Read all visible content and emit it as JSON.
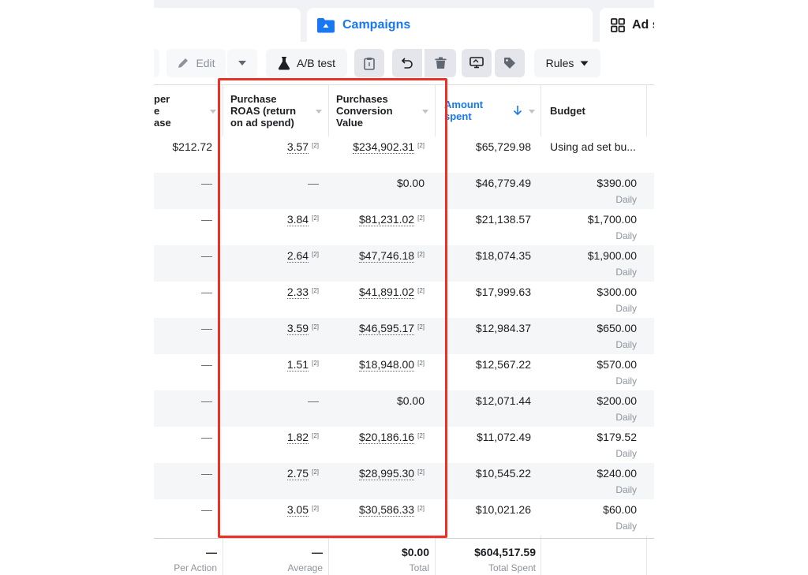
{
  "tabs": {
    "campaigns": "Campaigns",
    "ads": "Ad s"
  },
  "toolbar": {
    "edit": "Edit",
    "ab_test": "A/B test",
    "rules": "Rules"
  },
  "columns": {
    "cost_per": [
      "per",
      "e",
      "ase"
    ],
    "roas": [
      "Purchase",
      "ROAS (return",
      "on ad spend)"
    ],
    "conv_value": [
      "Purchases",
      "Conversion",
      "Value"
    ],
    "amount_spent": [
      "Amount",
      "spent"
    ],
    "budget": "Budget"
  },
  "rows": [
    {
      "cost": "$212.72",
      "roas": "3.57",
      "value": "$234,902.31",
      "spent": "$65,729.98",
      "budget": "Using ad set bu...",
      "period": ""
    },
    {
      "cost": "—",
      "roas": "—",
      "value": "$0.00",
      "spent": "$46,779.49",
      "budget": "$390.00",
      "period": "Daily"
    },
    {
      "cost": "—",
      "roas": "3.84",
      "value": "$81,231.02",
      "spent": "$21,138.57",
      "budget": "$1,700.00",
      "period": "Daily"
    },
    {
      "cost": "—",
      "roas": "2.64",
      "value": "$47,746.18",
      "spent": "$18,074.35",
      "budget": "$1,900.00",
      "period": "Daily"
    },
    {
      "cost": "—",
      "roas": "2.33",
      "value": "$41,891.02",
      "spent": "$17,999.63",
      "budget": "$300.00",
      "period": "Daily"
    },
    {
      "cost": "—",
      "roas": "3.59",
      "value": "$46,595.17",
      "spent": "$12,984.37",
      "budget": "$650.00",
      "period": "Daily"
    },
    {
      "cost": "—",
      "roas": "1.51",
      "value": "$18,948.00",
      "spent": "$12,567.22",
      "budget": "$570.00",
      "period": "Daily"
    },
    {
      "cost": "—",
      "roas": "—",
      "value": "$0.00",
      "spent": "$12,071.44",
      "budget": "$200.00",
      "period": "Daily"
    },
    {
      "cost": "—",
      "roas": "1.82",
      "value": "$20,186.16",
      "spent": "$11,072.49",
      "budget": "$179.52",
      "period": "Daily"
    },
    {
      "cost": "—",
      "roas": "2.75",
      "value": "$28,995.30",
      "spent": "$10,545.22",
      "budget": "$240.00",
      "period": "Daily"
    },
    {
      "cost": "—",
      "roas": "3.05",
      "value": "$30,586.33",
      "spent": "$10,021.26",
      "budget": "$60.00",
      "period": "Daily"
    }
  ],
  "attribution_marker": "[2]",
  "summary": {
    "cost": "—",
    "cost_label": "Per Action",
    "roas": "—",
    "roas_label": "Average",
    "value": "$0.00",
    "value_label": "Total",
    "spent": "$604,517.59",
    "spent_label": "Total Spent"
  },
  "colors": {
    "accent": "#1877f2",
    "highlight": "#ee3124"
  }
}
